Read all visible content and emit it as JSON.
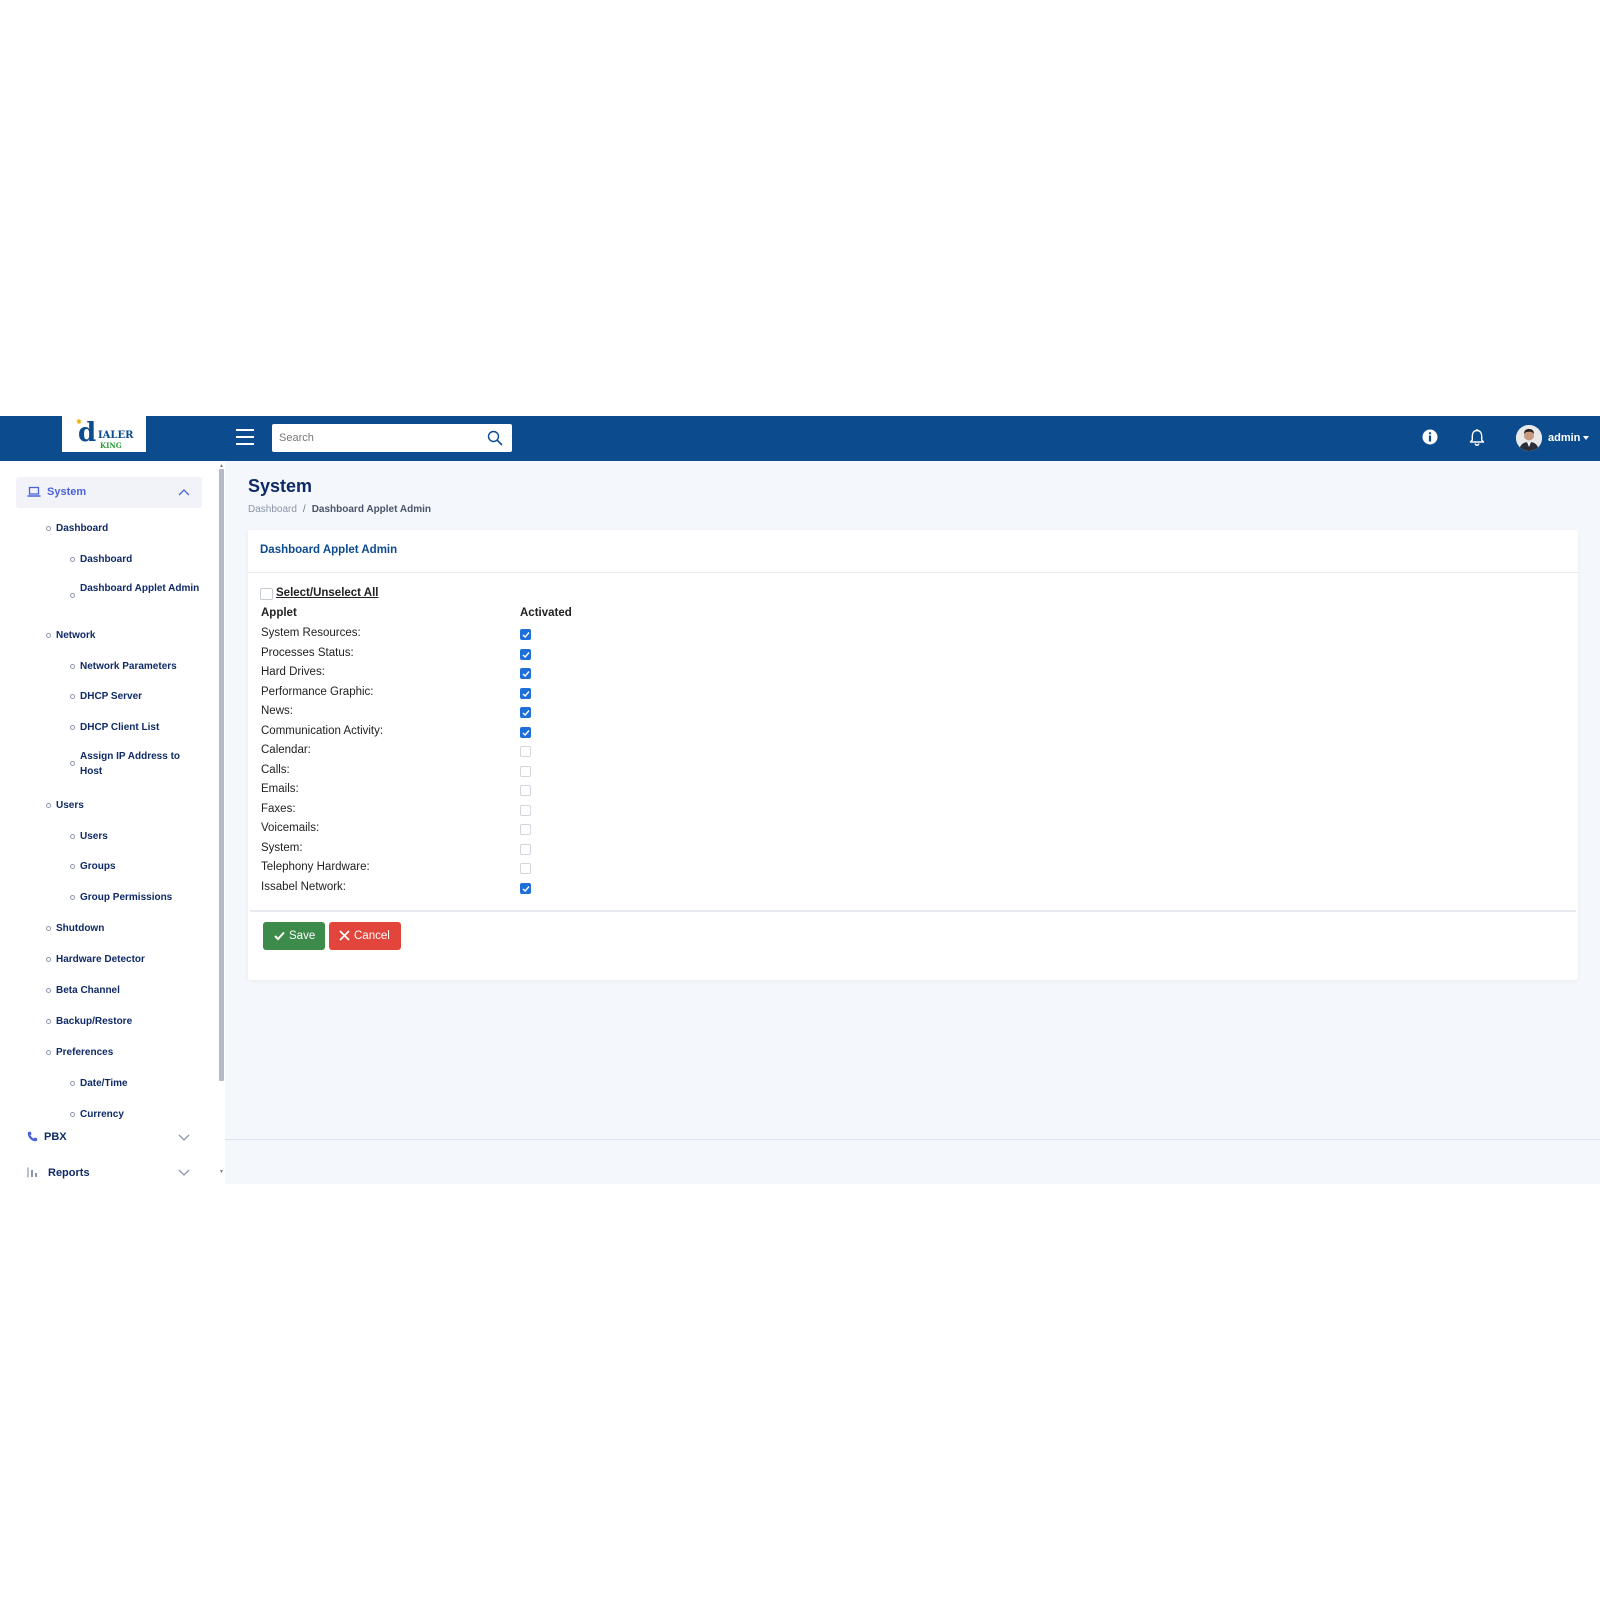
{
  "header": {
    "logo_text_main": "IALER",
    "logo_text_sub": "KING",
    "search_placeholder": "Search",
    "user_name": "admin"
  },
  "sidebar": {
    "system_label": "System",
    "items": [
      {
        "label": "Dashboard",
        "level": 1
      },
      {
        "label": "Dashboard",
        "level": 2
      },
      {
        "label": "Dashboard Applet Admin",
        "level": 2
      },
      {
        "label": "Network",
        "level": 1
      },
      {
        "label": "Network Parameters",
        "level": 2
      },
      {
        "label": "DHCP Server",
        "level": 2
      },
      {
        "label": "DHCP Client List",
        "level": 2
      },
      {
        "label": "Assign IP Address to Host",
        "level": 2
      },
      {
        "label": "Users",
        "level": 1
      },
      {
        "label": "Users",
        "level": 2
      },
      {
        "label": "Groups",
        "level": 2
      },
      {
        "label": "Group Permissions",
        "level": 2
      },
      {
        "label": "Shutdown",
        "level": 1
      },
      {
        "label": "Hardware Detector",
        "level": 1
      },
      {
        "label": "Beta Channel",
        "level": 1
      },
      {
        "label": "Backup/Restore",
        "level": 1
      },
      {
        "label": "Preferences",
        "level": 1
      },
      {
        "label": "Date/Time",
        "level": 2
      },
      {
        "label": "Currency",
        "level": 2
      }
    ],
    "pbx_label": "PBX",
    "reports_label": "Reports"
  },
  "page": {
    "title": "System",
    "breadcrumb_home": "Dashboard",
    "breadcrumb_sep": "/",
    "breadcrumb_current": "Dashboard Applet Admin"
  },
  "card": {
    "title": "Dashboard Applet Admin",
    "select_all_label": "Select/Unselect All",
    "col_applet": "Applet",
    "col_activated": "Activated",
    "applets": [
      {
        "label": "System Resources:",
        "activated": true
      },
      {
        "label": "Processes Status:",
        "activated": true
      },
      {
        "label": "Hard Drives:",
        "activated": true
      },
      {
        "label": "Performance Graphic:",
        "activated": true
      },
      {
        "label": "News:",
        "activated": true
      },
      {
        "label": "Communication Activity:",
        "activated": true
      },
      {
        "label": "Calendar:",
        "activated": false
      },
      {
        "label": "Calls:",
        "activated": false
      },
      {
        "label": "Emails:",
        "activated": false
      },
      {
        "label": "Faxes:",
        "activated": false
      },
      {
        "label": "Voicemails:",
        "activated": false
      },
      {
        "label": "System:",
        "activated": false
      },
      {
        "label": "Telephony Hardware:",
        "activated": false
      },
      {
        "label": "Issabel Network:",
        "activated": true
      }
    ],
    "save_label": "Save",
    "cancel_label": "Cancel"
  },
  "colors": {
    "header_bg": "#0c4b8e",
    "accent": "#4b63d8",
    "save": "#3d8b4a",
    "cancel": "#e2453c",
    "checkbox_on": "#1e6fd9"
  }
}
